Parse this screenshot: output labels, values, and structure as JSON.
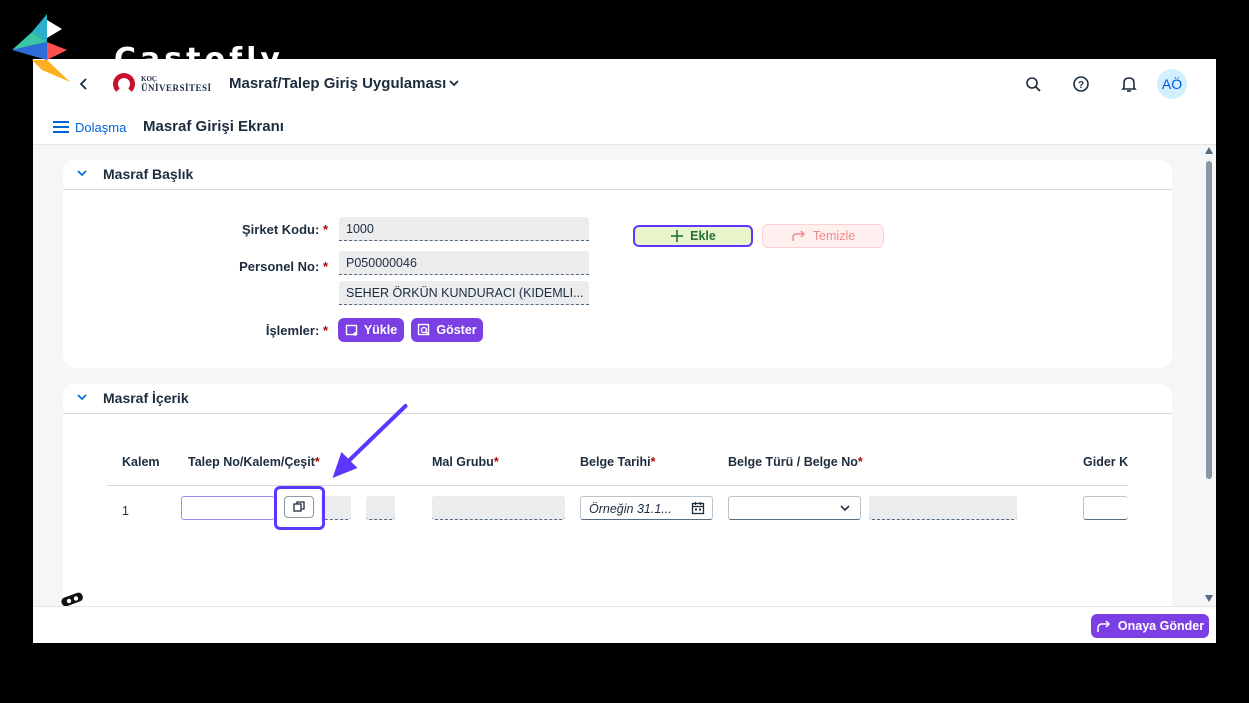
{
  "watermark": {
    "text": "Castofly"
  },
  "shell": {
    "back_icon": "chevron-left-icon",
    "logo_line1": "KOÇ",
    "logo_line2": "ÜNİVERSİTESİ",
    "app_title": "Masraf/Talep Giriş Uygulaması",
    "icons": [
      "search-icon",
      "help-icon",
      "bell-icon"
    ],
    "avatar_initials": "AÖ"
  },
  "subheader": {
    "nav_label": "Dolaşma",
    "page_title": "Masraf Girişi Ekranı"
  },
  "header_panel": {
    "title": "Masraf Başlık",
    "company_label": "Şirket Kodu:",
    "company_value": "1000",
    "personnel_label": "Personel No:",
    "personnel_value": "P050000046",
    "personnel_name": "SEHER ÖRKÜN KUNDURACI (KIDEMLI...",
    "operations_label": "İşlemler:",
    "load_button": "Yükle",
    "show_button": "Göster",
    "add_button": "Ekle",
    "clear_button": "Temizle",
    "required_mark": "*"
  },
  "content_panel": {
    "title": "Masraf İçerik",
    "columns": [
      "Kalem",
      "Talep No/Kalem/Çeşit",
      "Mal Grubu",
      "Belge Tarihi",
      "Belge Türü / Belge No",
      "Gider Ka"
    ],
    "required_columns": [
      1,
      2,
      3,
      4
    ],
    "rows": [
      {
        "kalem": "1",
        "date_placeholder": "Örneğin 31.1..."
      }
    ]
  },
  "footer": {
    "submit_button": "Onaya Gönder"
  },
  "colors": {
    "accent": "#7b3fe4",
    "highlight": "#5d36ff",
    "text": "#1d2d3e",
    "required": "#aa0808"
  }
}
